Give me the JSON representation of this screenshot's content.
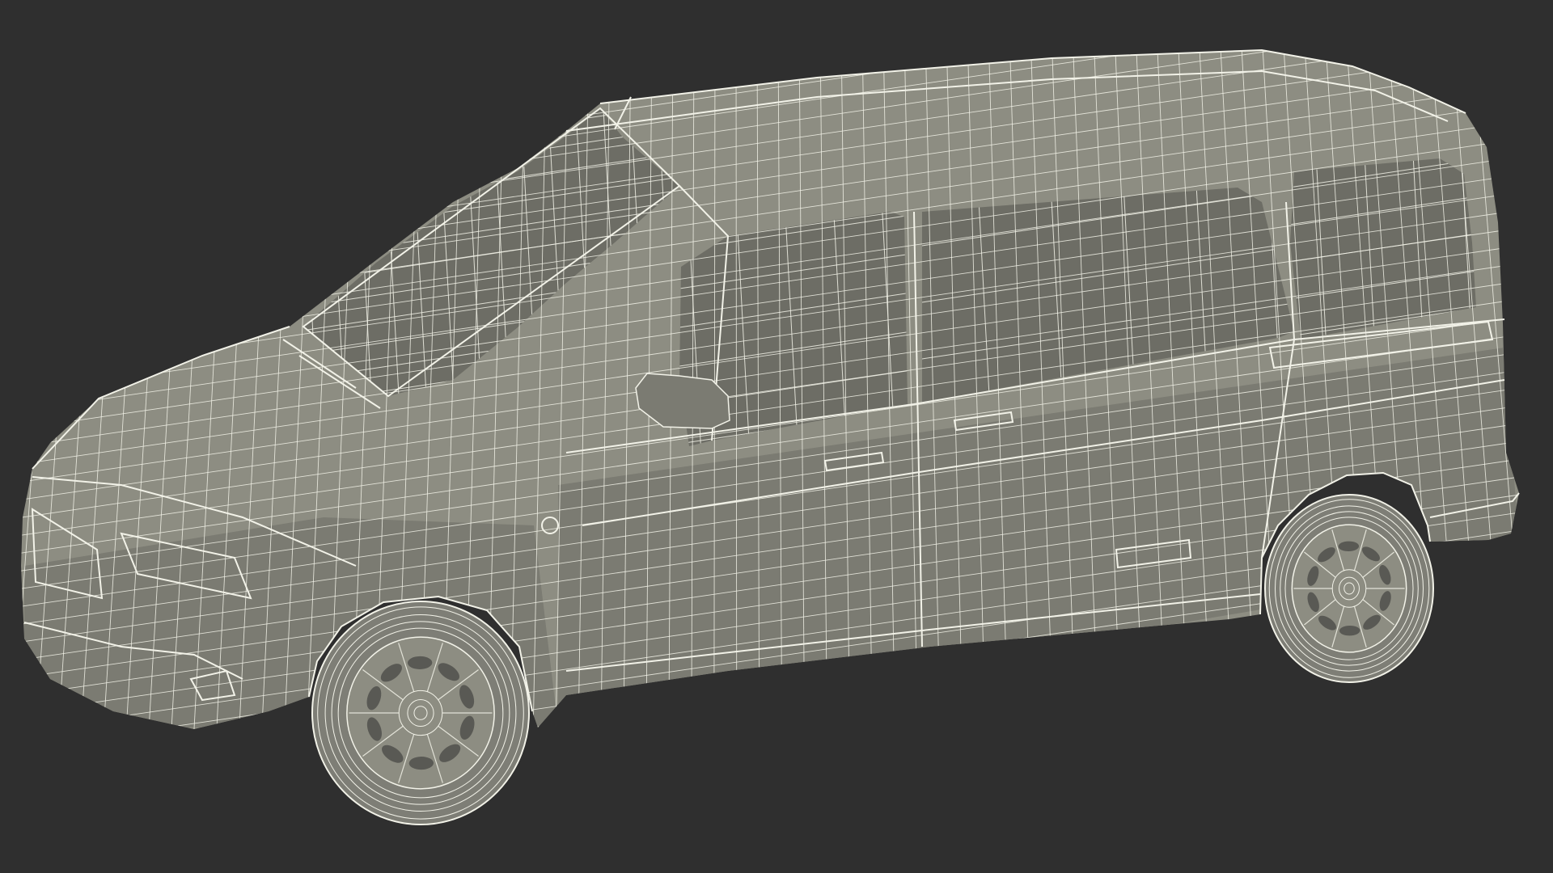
{
  "scene": {
    "background_color": "#2f2f2f",
    "body_color": "#8d8d82",
    "body_shade_color": "#7b7b72",
    "glass_color": "#6d6d65",
    "wire_color": "#f2f2e8",
    "tire_color": "#7e7e76",
    "subject": "van-wireframe-model"
  }
}
